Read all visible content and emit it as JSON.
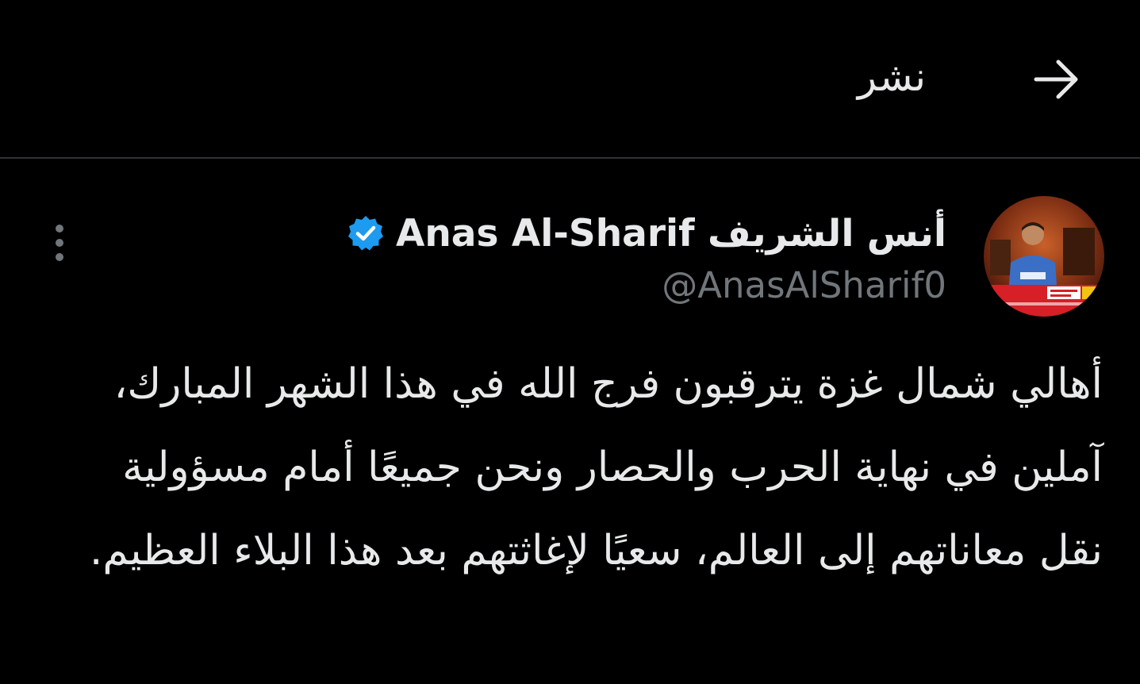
{
  "header": {
    "title": "نشر",
    "back_icon": "arrow-right-icon"
  },
  "post": {
    "author": {
      "display_name": "Anas Al-Sharif أنس الشريف",
      "handle": "@AnasAlSharif0",
      "verified": true,
      "verified_icon": "verified-badge-icon",
      "avatar_icon": "avatar-photo"
    },
    "more_icon": "more-vertical-icon",
    "text": "أهالي شمال غزة يترقبون فرج الله في هذا الشهر المبارك، آملين في نهاية الحرب والحصار ونحن جميعًا أمام مسؤولية نقل معاناتهم إلى العالم، سعيًا لإغاثتهم بعد هذا البلاء العظيم."
  },
  "colors": {
    "background": "#000000",
    "text_primary": "#e7e9ea",
    "text_secondary": "#71767b",
    "divider": "#2f3336",
    "verified_blue": "#1d9bf0"
  }
}
